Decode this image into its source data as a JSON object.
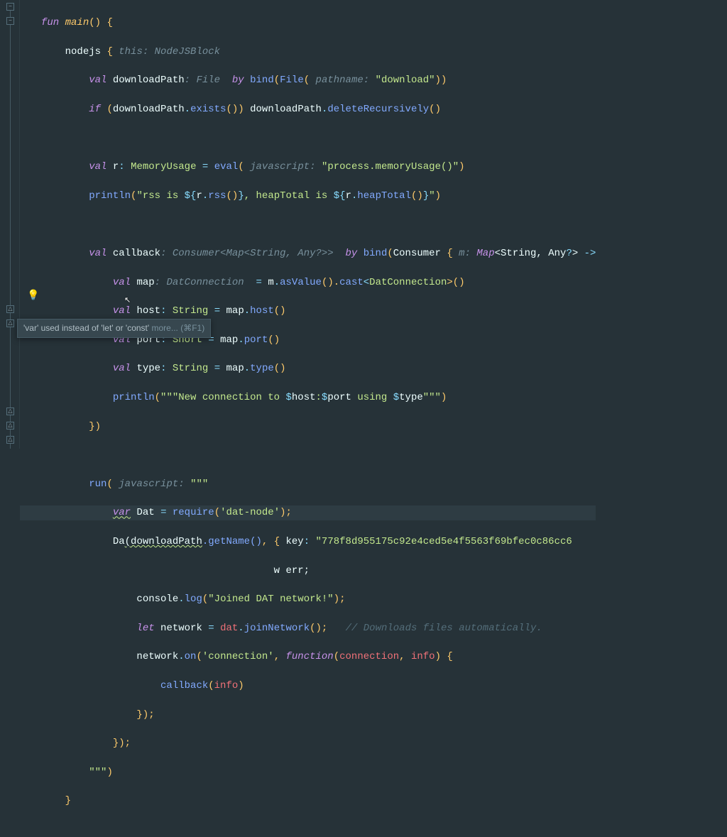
{
  "tooltip": {
    "text": "'var' used instead of 'let' or 'const'",
    "more": "more... (⌘F1)"
  },
  "lines": {
    "l1": {
      "fun": "fun",
      "main": "main",
      "op": "()",
      "brace": "{"
    },
    "l2": {
      "ident": "nodejs",
      "brace": "{",
      "param": " this: NodeJSBlock"
    },
    "l3": {
      "val": "val",
      "name": "downloadPath",
      "paramType": ": File ",
      "by": "by",
      "bind": "bind",
      "lp": "(",
      "fileFn": "File",
      "lp2": "(",
      "param": " pathname: ",
      "str": "\"download\"",
      "rp": "))"
    },
    "l4": {
      "if": "if",
      "lp": "(",
      "dp": "downloadPath",
      "dot": ".",
      "exists": "exists",
      "call": "()) ",
      "dp2": "downloadPath",
      "dot2": ".",
      "del": "deleteRecursively",
      "call2": "()"
    },
    "l6": {
      "val": "val",
      "name": "r",
      "colon": ": ",
      "type": "MemoryUsage",
      "eq": " = ",
      "eval": "eval",
      "lp": "(",
      "param": " javascript: ",
      "str": "\"process.memoryUsage()\"",
      "rp": ")"
    },
    "l7": {
      "println": "println",
      "lp": "(",
      "str1": "\"rss is ",
      "int": "${",
      "r1": "r",
      "dot1": ".",
      "rss": "rss",
      "call1": "()",
      "ce": "}",
      "str2": ", heapTotal is ",
      "int2": "${",
      "r2": "r",
      "dot2": ".",
      "ht": "heapTotal",
      "call2": "()",
      "ce2": "}",
      "strEnd": "\"",
      "rp": ")"
    },
    "l9": {
      "val": "val",
      "name": "callback",
      "paramType": ": Consumer<Map<String, Any?>> ",
      "by": "by",
      "bind": "bind",
      "lp": "(",
      "cons": "Consumer",
      "brace": " {",
      "param": " m: ",
      "mapType": "Map",
      "angle": "<String, Any",
      "q": "?",
      "angle2": "> ",
      "arrow": "->"
    },
    "l10": {
      "val": "val",
      "name": "map",
      "paramType": ": DatConnection ",
      "eq": " = ",
      "m": "m",
      "dot": ".",
      "asVal": "asValue",
      "call": "().",
      "cast": "cast",
      "angle": "<",
      "dcType": "DatConnection",
      "angle2": ">()"
    },
    "l11": {
      "val": "val",
      "name": "host",
      "colon": ": ",
      "type": "String",
      "eq": " = ",
      "map": "map",
      "dot": ".",
      "host": "host",
      "call": "()"
    },
    "l12": {
      "val": "val",
      "name": "port",
      "colon": ": ",
      "type": "Short",
      "eq": " = ",
      "map": "map",
      "dot": ".",
      "port": "port",
      "call": "()"
    },
    "l13": {
      "val": "val",
      "name": "type",
      "colon": ": ",
      "type": "String",
      "eq": " = ",
      "map": "map",
      "dot": ".",
      "typeFn": "type",
      "call": "()"
    },
    "l14": {
      "println": "println",
      "lp": "(",
      "str": "\"\"\"New connection to ",
      "int1": "$",
      "host": "host",
      "str2": ":",
      "int2": "$",
      "port": "port",
      "str3": " using ",
      "int3": "$",
      "type": "type",
      "strEnd": "\"\"\"",
      "rp": ")"
    },
    "l15": {
      "brace": "})"
    },
    "l17": {
      "run": "run",
      "lp": "(",
      "param": " javascript: ",
      "str": "\"\"\""
    },
    "l18a": {
      "var": "var",
      "name": "Dat ",
      "eq": "= ",
      "req": "require",
      "lp": "(",
      "str": "'dat-node'",
      "rp": ");"
    },
    "l18b": {
      "partial": "Da",
      "wavy": "(downloadPath",
      "getName": ".getName()",
      "comma": ", ",
      "brace": "{ ",
      "key": "key",
      "colon": ": ",
      "str": "\"778f8d955175c92e4ced5e4f5563f69bfec0c86cc6"
    },
    "l18c": {
      "text": "w err;"
    },
    "l19": {
      "console": "console",
      "dot": ".",
      "log": "log",
      "lp": "(",
      "str": "\"Joined DAT network!\"",
      "rp": ");"
    },
    "l20": {
      "let": "let",
      "name": "network ",
      "eq": "= ",
      "dat": "dat",
      "dot": ".",
      "join": "joinNetwork",
      "call": "();",
      "comment": "// Downloads files automatically."
    },
    "l21": {
      "network": "network",
      "dot": ".",
      "on": "on",
      "lp": "(",
      "str": "'connection'",
      "comma": ", ",
      "func": "function",
      "lp2": "(",
      "conn": "connection",
      "comma2": ", ",
      "info": "info",
      "rp": ") ",
      "brace": "{"
    },
    "l22": {
      "callback": "callback",
      "lp": "(",
      "info": "info",
      "rp": ")"
    },
    "l23": {
      "brace": "});"
    },
    "l24": {
      "brace": "});"
    },
    "l25": {
      "str": "\"\"\"",
      "rp": ")"
    },
    "l26": {
      "brace": "}"
    }
  }
}
